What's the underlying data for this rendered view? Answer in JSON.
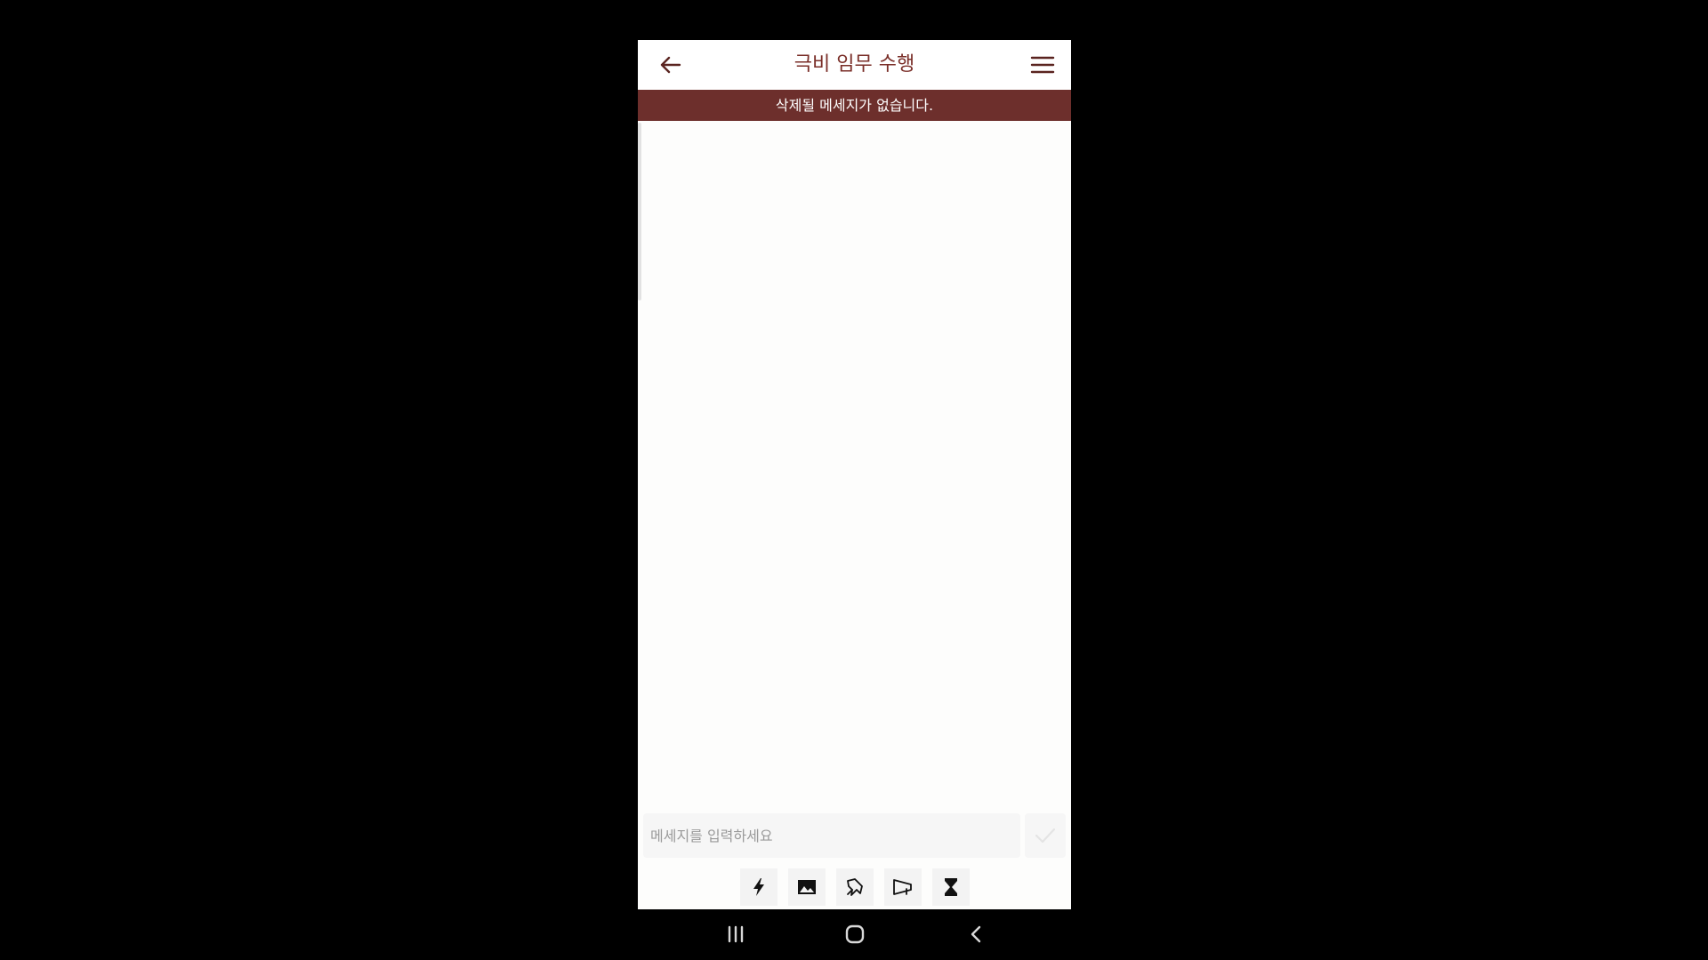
{
  "header": {
    "title": "극비 임무 수행",
    "back_icon": "arrow-left-icon",
    "menu_icon": "hamburger-menu-icon"
  },
  "banner": {
    "text": "삭제될 메세지가 없습니다."
  },
  "composer": {
    "placeholder": "메세지를 입력하세요",
    "value": "",
    "send_icon": "check-icon"
  },
  "toolbar": {
    "items": [
      {
        "icon": "lightning-icon"
      },
      {
        "icon": "image-icon"
      },
      {
        "icon": "pin-icon"
      },
      {
        "icon": "megaphone-icon"
      },
      {
        "icon": "hourglass-icon"
      }
    ]
  },
  "system_nav": {
    "items": [
      {
        "icon": "recent-apps-icon"
      },
      {
        "icon": "home-icon"
      },
      {
        "icon": "back-chevron-icon"
      }
    ]
  },
  "colors": {
    "accent": "#6d2f2c",
    "title": "#7a2e28",
    "background": "#fdfdfc",
    "outer": "#000000"
  }
}
